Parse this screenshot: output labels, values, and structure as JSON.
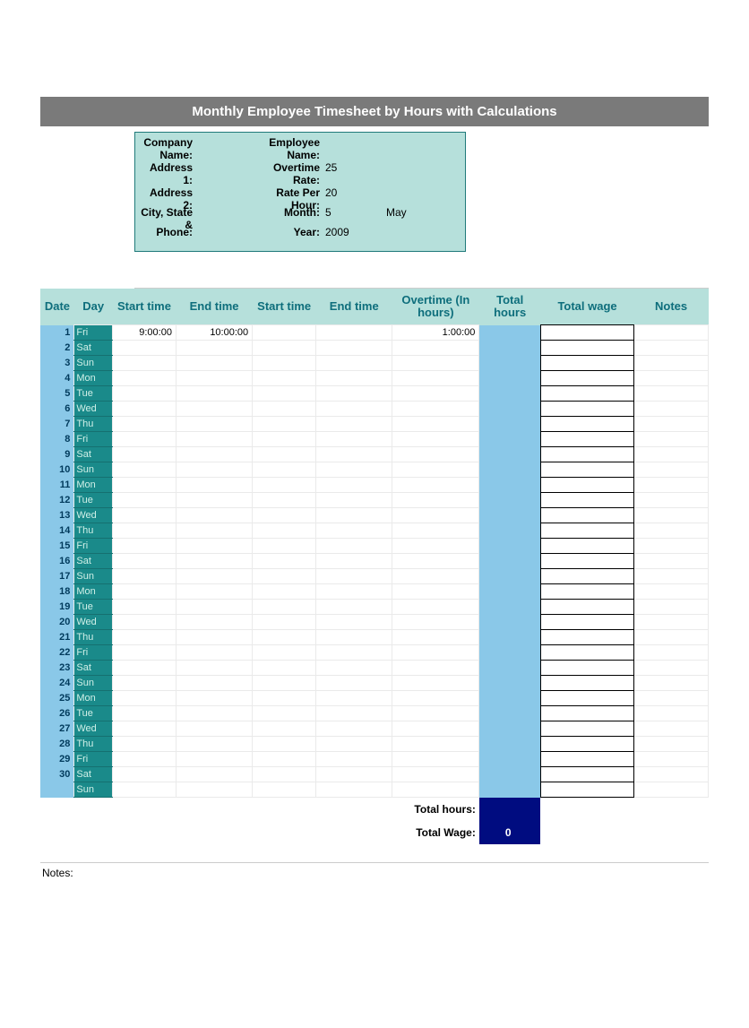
{
  "title": "Monthly Employee Timesheet by Hours with Calculations",
  "info": {
    "company_label": "Company Name:",
    "employee_label": "Employee Name:",
    "address1_label": "Address 1:",
    "address2_label": "Address 2:",
    "city_label": "City, State &",
    "phone_label": "Phone:",
    "overtime_label": "Overtime Rate:",
    "rate_label": "Rate Per Hour:",
    "month_label": "Month:",
    "year_label": "Year:",
    "overtime_value": "25",
    "rate_value": "20",
    "month_number": "5",
    "month_name": "May",
    "year_value": "2009"
  },
  "headers": {
    "date": "Date",
    "day": "Day",
    "start1": "Start time",
    "end1": "End time",
    "start2": "Start time",
    "end2": "End time",
    "overtime": "Overtime (In hours)",
    "total_hours": "Total hours",
    "total_wage": "Total wage",
    "notes": "Notes"
  },
  "rows": [
    {
      "date": "1",
      "day": "Fri",
      "start1": "9:00:00",
      "end1": "10:00:00",
      "start2": "",
      "end2": "",
      "ot": "1:00:00"
    },
    {
      "date": "2",
      "day": "Sat",
      "start1": "",
      "end1": "",
      "start2": "",
      "end2": "",
      "ot": ""
    },
    {
      "date": "3",
      "day": "Sun",
      "start1": "",
      "end1": "",
      "start2": "",
      "end2": "",
      "ot": ""
    },
    {
      "date": "4",
      "day": "Mon",
      "start1": "",
      "end1": "",
      "start2": "",
      "end2": "",
      "ot": ""
    },
    {
      "date": "5",
      "day": "Tue",
      "start1": "",
      "end1": "",
      "start2": "",
      "end2": "",
      "ot": ""
    },
    {
      "date": "6",
      "day": "Wed",
      "start1": "",
      "end1": "",
      "start2": "",
      "end2": "",
      "ot": ""
    },
    {
      "date": "7",
      "day": "Thu",
      "start1": "",
      "end1": "",
      "start2": "",
      "end2": "",
      "ot": ""
    },
    {
      "date": "8",
      "day": "Fri",
      "start1": "",
      "end1": "",
      "start2": "",
      "end2": "",
      "ot": ""
    },
    {
      "date": "9",
      "day": "Sat",
      "start1": "",
      "end1": "",
      "start2": "",
      "end2": "",
      "ot": ""
    },
    {
      "date": "10",
      "day": "Sun",
      "start1": "",
      "end1": "",
      "start2": "",
      "end2": "",
      "ot": ""
    },
    {
      "date": "11",
      "day": "Mon",
      "start1": "",
      "end1": "",
      "start2": "",
      "end2": "",
      "ot": ""
    },
    {
      "date": "12",
      "day": "Tue",
      "start1": "",
      "end1": "",
      "start2": "",
      "end2": "",
      "ot": ""
    },
    {
      "date": "13",
      "day": "Wed",
      "start1": "",
      "end1": "",
      "start2": "",
      "end2": "",
      "ot": ""
    },
    {
      "date": "14",
      "day": "Thu",
      "start1": "",
      "end1": "",
      "start2": "",
      "end2": "",
      "ot": ""
    },
    {
      "date": "15",
      "day": "Fri",
      "start1": "",
      "end1": "",
      "start2": "",
      "end2": "",
      "ot": ""
    },
    {
      "date": "16",
      "day": "Sat",
      "start1": "",
      "end1": "",
      "start2": "",
      "end2": "",
      "ot": ""
    },
    {
      "date": "17",
      "day": "Sun",
      "start1": "",
      "end1": "",
      "start2": "",
      "end2": "",
      "ot": ""
    },
    {
      "date": "18",
      "day": "Mon",
      "start1": "",
      "end1": "",
      "start2": "",
      "end2": "",
      "ot": ""
    },
    {
      "date": "19",
      "day": "Tue",
      "start1": "",
      "end1": "",
      "start2": "",
      "end2": "",
      "ot": ""
    },
    {
      "date": "20",
      "day": "Wed",
      "start1": "",
      "end1": "",
      "start2": "",
      "end2": "",
      "ot": ""
    },
    {
      "date": "21",
      "day": "Thu",
      "start1": "",
      "end1": "",
      "start2": "",
      "end2": "",
      "ot": ""
    },
    {
      "date": "22",
      "day": "Fri",
      "start1": "",
      "end1": "",
      "start2": "",
      "end2": "",
      "ot": ""
    },
    {
      "date": "23",
      "day": "Sat",
      "start1": "",
      "end1": "",
      "start2": "",
      "end2": "",
      "ot": ""
    },
    {
      "date": "24",
      "day": "Sun",
      "start1": "",
      "end1": "",
      "start2": "",
      "end2": "",
      "ot": ""
    },
    {
      "date": "25",
      "day": "Mon",
      "start1": "",
      "end1": "",
      "start2": "",
      "end2": "",
      "ot": ""
    },
    {
      "date": "26",
      "day": "Tue",
      "start1": "",
      "end1": "",
      "start2": "",
      "end2": "",
      "ot": ""
    },
    {
      "date": "27",
      "day": "Wed",
      "start1": "",
      "end1": "",
      "start2": "",
      "end2": "",
      "ot": ""
    },
    {
      "date": "28",
      "day": "Thu",
      "start1": "",
      "end1": "",
      "start2": "",
      "end2": "",
      "ot": ""
    },
    {
      "date": "29",
      "day": "Fri",
      "start1": "",
      "end1": "",
      "start2": "",
      "end2": "",
      "ot": ""
    },
    {
      "date": "30",
      "day": "Sat",
      "start1": "",
      "end1": "",
      "start2": "",
      "end2": "",
      "ot": ""
    },
    {
      "date": "",
      "day": "Sun",
      "start1": "",
      "end1": "",
      "start2": "",
      "end2": "",
      "ot": ""
    }
  ],
  "totals": {
    "total_hours_label": "Total hours:",
    "total_wage_label": "Total Wage:",
    "total_hours_value": "",
    "total_wage_value": "0"
  },
  "notes_label": "Notes:"
}
